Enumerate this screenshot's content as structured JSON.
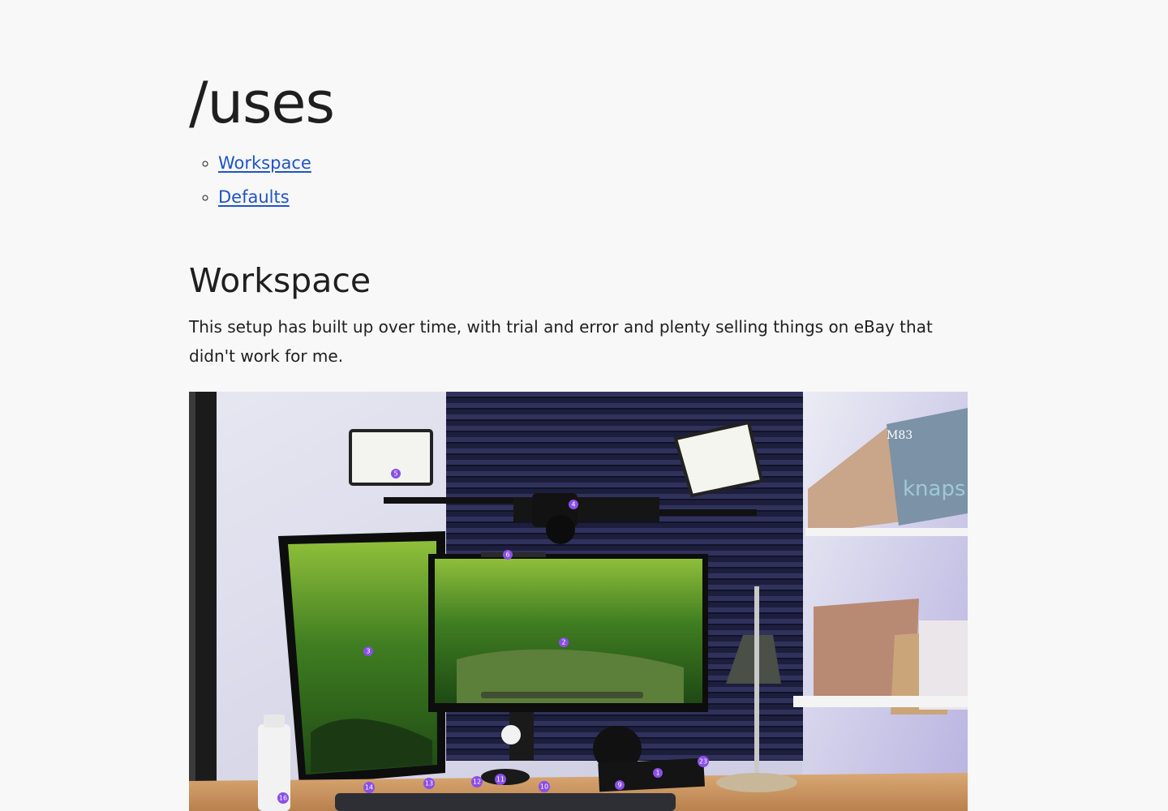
{
  "page": {
    "title": "/uses"
  },
  "toc": [
    {
      "label": "Workspace"
    },
    {
      "label": "Defaults"
    }
  ],
  "workspace": {
    "heading": "Workspace",
    "intro": "This setup has built up over time, with trial and error and plenty selling things on eBay that didn't work for me."
  },
  "photo": {
    "markers": [
      "5",
      "4",
      "6",
      "3",
      "2",
      "1",
      "23",
      "16",
      "14",
      "13",
      "12",
      "11",
      "10",
      "9"
    ],
    "poster_text": [
      "M83",
      "knaps"
    ]
  },
  "colors": {
    "background": "#f8f8f8",
    "text": "#1f1f1f",
    "link": "#1e54c9",
    "marker": "#8a4fe6"
  }
}
